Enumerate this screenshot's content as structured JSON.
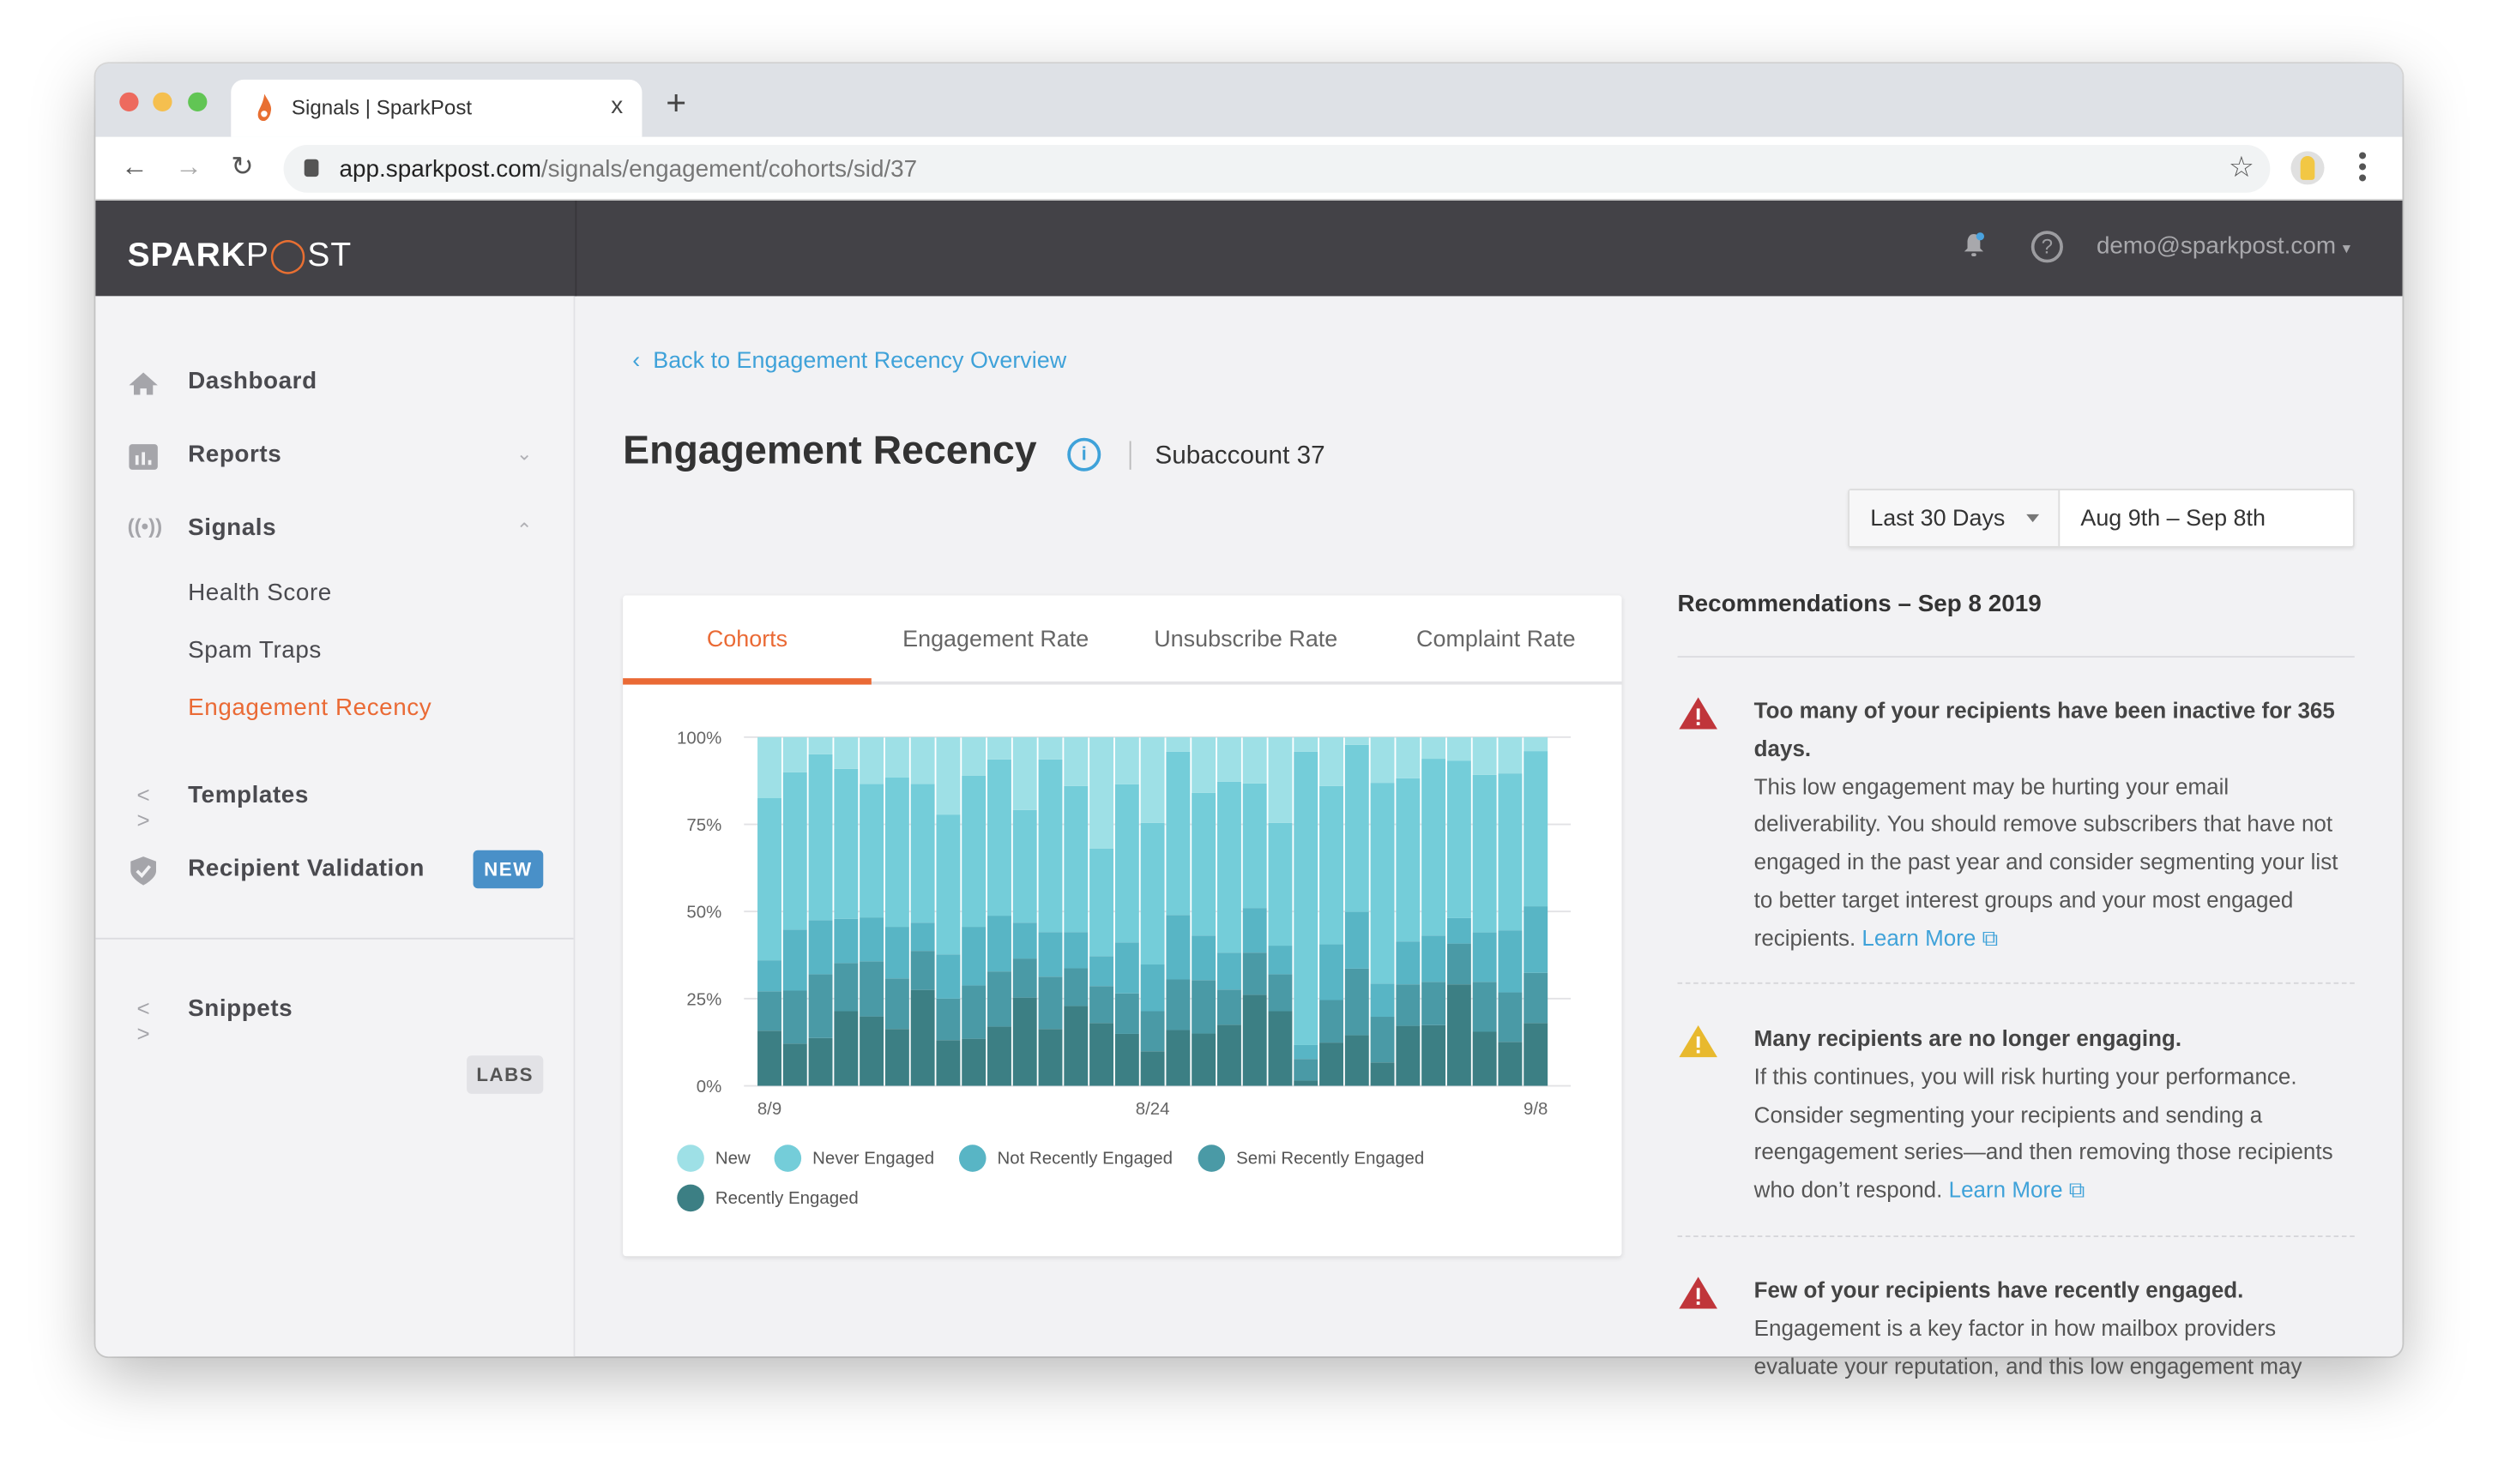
{
  "browser": {
    "tab_title": "Signals | SparkPost",
    "tab_close": "x",
    "new_tab": "+",
    "url_host": "app.sparkpost.com",
    "url_path": "/signals/engagement/cohorts/sid/37"
  },
  "header": {
    "logo": "SPARKPOST",
    "user": "demo@sparkpost.com",
    "help": "?"
  },
  "sidebar": {
    "items": [
      {
        "label": "Dashboard"
      },
      {
        "label": "Reports"
      },
      {
        "label": "Signals"
      },
      {
        "label": "Health Score"
      },
      {
        "label": "Spam Traps"
      },
      {
        "label": "Engagement Recency"
      },
      {
        "label": "Templates"
      },
      {
        "label": "Recipient Validation",
        "badge": "NEW"
      },
      {
        "label": "Snippets",
        "badge": "LABS"
      }
    ]
  },
  "page": {
    "back_link": "Back to Engagement Recency Overview",
    "title": "Engagement Recency",
    "info": "i",
    "subaccount": "Subaccount 37",
    "range": "Last 30 Days",
    "dates": "Aug 9th – Sep 8th"
  },
  "tabs": [
    "Cohorts",
    "Engagement Rate",
    "Unsubscribe Rate",
    "Complaint Rate"
  ],
  "colors": {
    "accent": "#ea6a35",
    "link": "#3fa2d9",
    "danger": "#c0353a",
    "warning": "#e8b92e"
  },
  "chart_data": {
    "type": "bar",
    "stacked": true,
    "title": "",
    "xlabel": "",
    "ylabel": "",
    "ylim": [
      0,
      100
    ],
    "yticks": [
      "0%",
      "25%",
      "50%",
      "75%",
      "100%"
    ],
    "xticks": [
      "8/9",
      "8/24",
      "9/8"
    ],
    "categories": [
      "8/9",
      "8/10",
      "8/11",
      "8/12",
      "8/13",
      "8/14",
      "8/15",
      "8/16",
      "8/17",
      "8/18",
      "8/19",
      "8/20",
      "8/21",
      "8/22",
      "8/23",
      "8/24",
      "8/25",
      "8/26",
      "8/27",
      "8/28",
      "8/29",
      "8/30",
      "8/31",
      "9/1",
      "9/2",
      "9/3",
      "9/4",
      "9/5",
      "9/6",
      "9/7",
      "9/8"
    ],
    "legend_position": "bottom",
    "series": [
      {
        "name": "Recently Engaged",
        "color": "#3c7f84",
        "values": [
          15.8,
          12.1,
          13.7,
          21.4,
          19.9,
          16.3,
          27.5,
          13.1,
          13.5,
          17.0,
          25.3,
          16.3,
          22.9,
          18.0,
          14.9,
          9.9,
          16.0,
          15.0,
          17.5,
          26.1,
          21.4,
          1.5,
          12.4,
          14.5,
          6.7,
          17.2,
          17.4,
          29.1,
          15.5,
          12.6,
          18.0
        ]
      },
      {
        "name": "Semi Recently Engaged",
        "color": "#4a9aa6",
        "values": [
          11.3,
          15.2,
          18.3,
          13.8,
          15.8,
          14.5,
          11.2,
          11.9,
          15.3,
          15.8,
          11.2,
          15.0,
          10.8,
          10.6,
          11.6,
          11.5,
          14.5,
          15.3,
          10.1,
          12.1,
          10.6,
          6.2,
          12.2,
          19.1,
          13.1,
          11.9,
          12.4,
          11.7,
          14.3,
          14.2,
          14.4
        ]
      },
      {
        "name": "Not Recently Engaged",
        "color": "#58b5c5",
        "values": [
          8.9,
          17.5,
          15.5,
          12.7,
          12.6,
          14.8,
          8.1,
          12.7,
          16.8,
          16.0,
          10.3,
          12.8,
          10.4,
          8.6,
          14.6,
          13.4,
          18.5,
          12.8,
          10.6,
          12.8,
          8.2,
          4.0,
          16.0,
          16.3,
          9.5,
          12.3,
          13.3,
          7.3,
          14.2,
          17.8,
          19.1
        ]
      },
      {
        "name": "Never Engaged",
        "color": "#74cdd9",
        "values": [
          46.5,
          45.1,
          47.6,
          43.0,
          38.3,
          42.8,
          39.8,
          40.1,
          43.3,
          44.8,
          32.3,
          49.5,
          41.9,
          30.8,
          45.4,
          40.6,
          46.8,
          40.9,
          49.0,
          35.7,
          35.2,
          84.1,
          45.4,
          47.9,
          57.6,
          46.8,
          50.7,
          45.1,
          45.2,
          45.0,
          44.5
        ]
      },
      {
        "name": "New",
        "color": "#9ee0e6",
        "values": [
          17.5,
          10.1,
          4.9,
          9.1,
          13.4,
          11.6,
          13.4,
          22.2,
          11.1,
          6.4,
          20.9,
          6.4,
          14.0,
          32.0,
          13.5,
          24.6,
          4.2,
          16.0,
          12.8,
          13.3,
          24.6,
          4.2,
          14.0,
          2.2,
          13.1,
          11.8,
          6.2,
          6.8,
          10.8,
          10.4,
          4.0
        ]
      }
    ],
    "legend": [
      "New",
      "Never Engaged",
      "Not Recently Engaged",
      "Semi Recently Engaged",
      "Recently Engaged"
    ]
  },
  "recommendations": {
    "title": "Recommendations – Sep 8 2019",
    "items": [
      {
        "level": "danger",
        "heading": "Too many of your recipients have been inactive for 365 days.",
        "body": "This low engagement may be hurting your email deliverability. You should remove subscribers that have not engaged in the past year and consider segmenting your list to better target interest groups and your most engaged recipients.",
        "link": "Learn More"
      },
      {
        "level": "warning",
        "heading": "Many recipients are no longer engaging.",
        "body": "If this continues, you will risk hurting your performance. Consider segmenting your recipients and sending a reengagement series—and then removing those recipients who don’t respond.",
        "link": "Learn More"
      },
      {
        "level": "danger",
        "heading": "Few of your recipients have recently engaged.",
        "body": "Engagement is a key factor in how mailbox providers evaluate your reputation, and this low engagement may"
      }
    ]
  }
}
